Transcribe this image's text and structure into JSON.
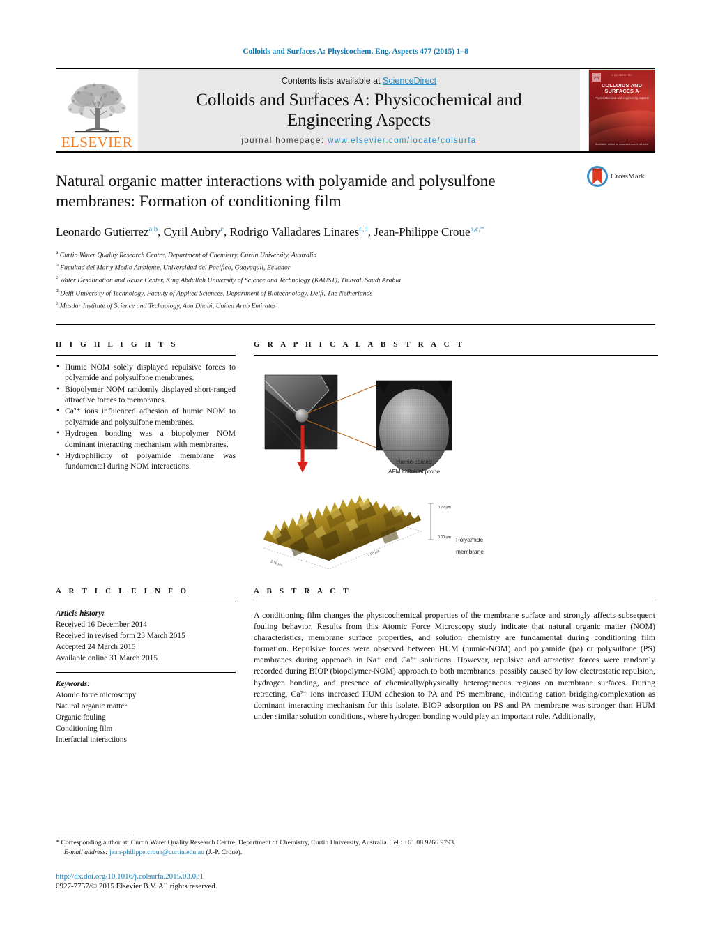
{
  "running_head": "Colloids and Surfaces A: Physicochem. Eng. Aspects 477 (2015) 1–8",
  "masthead": {
    "contents_prefix": "Contents lists available at ",
    "sciencedirect": "ScienceDirect",
    "journal_title": "Colloids and Surfaces A: Physicochemical and Engineering Aspects",
    "homepage_prefix": "journal homepage: ",
    "homepage_url": "www.elsevier.com/locate/colsurfa",
    "elsevier_wordmark": "ELSEVIER",
    "cover": {
      "top_band": "ISSN 0927-7757",
      "journal_name": "COLLOIDS AND SURFACES A",
      "subtitle": "Physicochemical and engineering aspects",
      "bottom_band": "Available online at www.sciencedirect.com"
    }
  },
  "article": {
    "title": "Natural organic matter interactions with polyamide and polysulfone membranes: Formation of conditioning film",
    "crossmark_label": "CrossMark",
    "authors_html": "Leonardo Gutierrez<sup>a,b</sup>, Cyril Aubry<sup>e</sup>, Rodrigo Valladares Linares<sup>c,d</sup>, Jean-Philippe Croue<sup>a,c,</sup><sup>*</sup>",
    "affiliations": [
      {
        "marker": "a",
        "text": "Curtin Water Quality Research Centre, Department of Chemistry, Curtin University, Australia"
      },
      {
        "marker": "b",
        "text": "Facultad del Mar y Medio Ambiente, Universidad del Pacifico, Guayaquil, Ecuador"
      },
      {
        "marker": "c",
        "text": "Water Desalination and Reuse Center, King Abdullah University of Science and Technology (KAUST), Thuwal, Saudi Arabia"
      },
      {
        "marker": "d",
        "text": "Delft University of Technology, Faculty of Applied Sciences, Department of Biotechnology, Delft, The Netherlands"
      },
      {
        "marker": "e",
        "text": "Masdar Institute of Science and Technology, Abu Dhabi, United Arab Emirates"
      }
    ]
  },
  "highlights": {
    "heading": "H I G H L I G H T S",
    "items": [
      "Humic NOM solely displayed repulsive forces to polyamide and polysulfone membranes.",
      "Biopolymer NOM randomly displayed short-ranged attractive forces to membranes.",
      "Ca²⁺ ions influenced adhesion of humic NOM to polyamide and polysulfone membranes.",
      "Hydrogen bonding was a biopolymer NOM dominant interacting mechanism with membranes.",
      "Hydrophilicity of polyamide membrane was fundamental during NOM interactions."
    ]
  },
  "graphical_abstract": {
    "heading": "G R A P H I C A L   A B S T R A C T",
    "probe_caption_line1": "Humic-coated",
    "probe_caption_line2": "AFM colloidal probe",
    "afm_caption_line1": "Polyamide",
    "afm_caption_line2": "membrane",
    "z_max": "0.72 µm",
    "z_min": "0.00 µm",
    "x_axis": "2.50 µm",
    "y_axis": "2.50 µm"
  },
  "article_info": {
    "heading": "A R T I C L E   I N F O",
    "history_label": "Article history:",
    "history": [
      "Received 16 December 2014",
      "Received in revised form 23 March 2015",
      "Accepted 24 March 2015",
      "Available online 31 March 2015"
    ],
    "keywords_label": "Keywords:",
    "keywords": [
      "Atomic force microscopy",
      "Natural organic matter",
      "Organic fouling",
      "Conditioning film",
      "Interfacial interactions"
    ]
  },
  "abstract": {
    "heading": "A B S T R A C T",
    "body": "A conditioning film changes the physicochemical properties of the membrane surface and strongly affects subsequent fouling behavior. Results from this Atomic Force Microscopy study indicate that natural organic matter (NOM) characteristics, membrane surface properties, and solution chemistry are fundamental during conditioning film formation. Repulsive forces were observed between HUM (humic-NOM) and polyamide (pa) or polysulfone (PS) membranes during approach in Na⁺ and Ca²⁺ solutions. However, repulsive and attractive forces were randomly recorded during BIOP (biopolymer-NOM) approach to both membranes, possibly caused by low electrostatic repulsion, hydrogen bonding, and presence of chemically/physically heterogeneous regions on membrane surfaces. During retracting, Ca²⁺ ions increased HUM adhesion to PA and PS membrane, indicating cation bridging/complexation as dominant interacting mechanism for this isolate. BIOP adsorption on PS and PA membrane was stronger than HUM under similar solution conditions, where hydrogen bonding would play an important role. Additionally,"
  },
  "footer": {
    "corresponding_marker": "*",
    "corresponding_text": "Corresponding author at: Curtin Water Quality Research Centre, Department of Chemistry, Curtin University, Australia. Tel.: +61 08 9266 9793.",
    "email_label": "E-mail address:",
    "email": "jean-philippe.croue@curtin.edu.au",
    "email_owner": "(J.-P. Croue).",
    "doi": "http://dx.doi.org/10.1016/j.colsurfa.2015.03.031",
    "copyright": "0927-7757/© 2015 Elsevier B.V. All rights reserved."
  },
  "colors": {
    "link_blue": "#1b7fb8",
    "elsevier_orange": "#f47c20",
    "masthead_grey": "#e8e8e8",
    "cover_red": "#8d1519",
    "arrow_red": "#d6201b",
    "leader_orange": "#b5651d"
  }
}
